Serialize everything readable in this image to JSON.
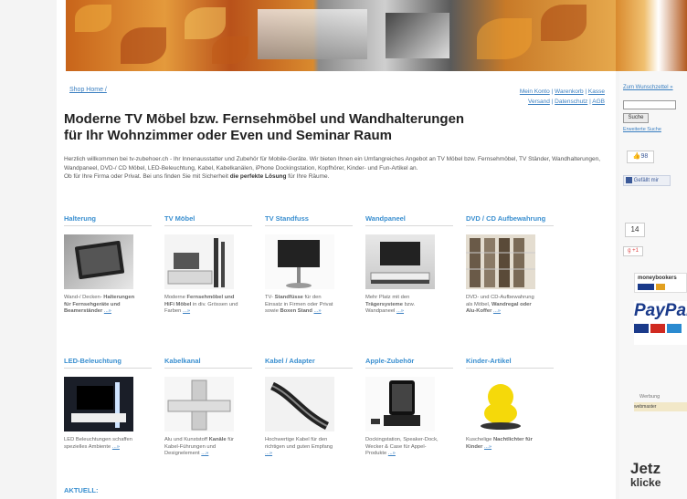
{
  "header": {},
  "breadcrumb": {
    "home": "Shop Home /"
  },
  "toplinks": [
    "Mein Konto",
    "Warenkorb",
    "Kasse",
    "Versand",
    "Datenschutz",
    "AGB"
  ],
  "page": {
    "title_line1": "Moderne TV Möbel bzw. Fernsehmöbel und Wandhalterungen",
    "title_line2": "für Ihr Wohnzimmer oder Even und Seminar Raum",
    "intro_p1": "Herzlich willkommen bei tv-zubehoer.ch - Ihr Innenausstatter und Zubehör für Mobile-Geräte. Wir bieten Ihnen ein Umfangreiches Angebot an TV Möbel bzw. Fernsehmöbel, TV Ständer, Wandhalterungen, Wandpaneel, DVD-/ CD Möbel, LED-Beleuchtung, Kabel, Kabelkanälen, iPhone Dockingstation, Kopfhörer, Kinder- und Fun-Artikel an.",
    "intro_p2_prefix": "Ob für Ihre Firma oder Privat. Bei uns finden Sie mit Sicherheit ",
    "intro_p2_bold": "die perfekte Lösung",
    "intro_p2_suffix": " für Ihre Räume."
  },
  "categories": [
    {
      "title": "Halterung",
      "desc": "Wand-/ Decken-",
      "desc_bold": "Halterungen für Fernsehgeräte und Beamerständer",
      "more": "...»"
    },
    {
      "title": "TV Möbel",
      "desc": "Moderne",
      "desc_bold": "Fernsehmöbel und HiFi Möbel",
      "desc_tail": "in div. Grössen und Farben",
      "more": "...»"
    },
    {
      "title": "TV Standfuss",
      "desc": "TV-",
      "desc_bold": "Standfüsse",
      "desc_tail": "für den Einsatz in Firmen oder Privat sowie",
      "desc_bold2": "Boxen Stand",
      "more": "...»"
    },
    {
      "title": "Wandpaneel",
      "desc": "Mehr Platz mit den",
      "desc_bold": "Trägersysteme",
      "desc_tail": "bzw. Wandpaneel",
      "more": "...»"
    },
    {
      "title": "DVD / CD Aufbewahrung",
      "desc": "DVD- und CD-Aufbewahrung als Möbel,",
      "desc_bold": "Wandregal oder Alu-Koffer",
      "more": "...»"
    },
    {
      "title": "LED-Beleuchtung",
      "desc": "LED Beleuchtungen schaffen spezielles Ambiente",
      "more": "...»"
    },
    {
      "title": "Kabelkanal",
      "desc": "Alu und Kunststoff",
      "desc_bold": "Kanäle",
      "desc_tail": "für Kabel-Führungen und Designelement",
      "more": "...»"
    },
    {
      "title": "Kabel / Adapter",
      "desc": "Hochwertige Kabel für den richtigen und guten Empfang",
      "more": "...»"
    },
    {
      "title": "Apple-Zubehör",
      "desc": "Dockingstation, Speaker-Dock, Wecker & Case für Appel-Produkte",
      "more": "...»"
    },
    {
      "title": "Kinder-Artikel",
      "desc": "Kuschelige",
      "desc_bold": "Nachtlichter für Kinder",
      "more": "...»"
    }
  ],
  "aktuell": "AKTUELL:",
  "sidebar": {
    "wishlist_link": "Zum Wunschzettel »",
    "search_placeholder": "",
    "search_button": "Suche",
    "advanced_search": "Erweiterte Suche",
    "like_count": "98",
    "fb_button": "Gefällt mir",
    "share_count": "14",
    "gplus": "+1",
    "moneybookers": "moneybookers",
    "paypal": "PayPal",
    "werbung": "Werbung",
    "webmaster": "webmaster",
    "jetzt": "Jetz",
    "klicken": "klicke"
  }
}
